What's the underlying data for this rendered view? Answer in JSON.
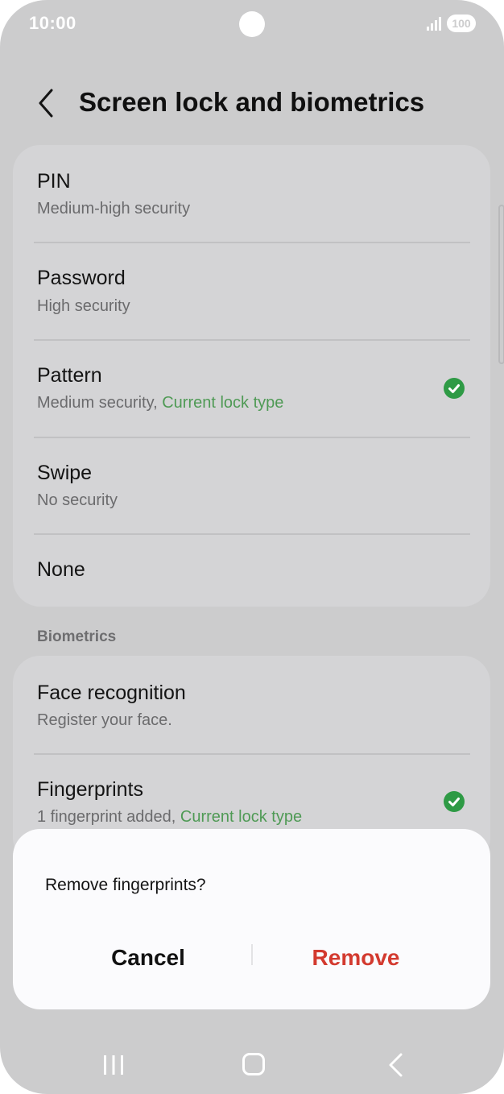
{
  "status_bar": {
    "time": "10:00",
    "battery": "100",
    "icons": [
      "camera-cutout",
      "signal-icon",
      "battery-icon"
    ]
  },
  "header": {
    "back_icon": "chevron-left-icon",
    "title": "Screen lock and biometrics"
  },
  "lock_types": [
    {
      "title": "PIN",
      "subtitle": "Medium-high security",
      "current": ""
    },
    {
      "title": "Password",
      "subtitle": "High security",
      "current": ""
    },
    {
      "title": "Pattern",
      "subtitle": "Medium security, ",
      "current": "Current lock type",
      "checked": true
    },
    {
      "title": "Swipe",
      "subtitle": "No security",
      "current": ""
    },
    {
      "title": "None",
      "subtitle": "",
      "current": ""
    }
  ],
  "biometrics": {
    "section_label": "Biometrics",
    "items": [
      {
        "title": "Face recognition",
        "subtitle": "Register your face.",
        "current": ""
      },
      {
        "title": "Fingerprints",
        "subtitle": "1 fingerprint added, ",
        "current": "Current lock type",
        "checked": true
      }
    ]
  },
  "dialog": {
    "message": "Remove fingerprints?",
    "cancel_label": "Cancel",
    "remove_label": "Remove"
  },
  "colors": {
    "overlay_background": "#cccccd",
    "accent_green": "#4f9a55",
    "check_green": "#2e9a45",
    "destructive_red": "#d33a2f"
  },
  "nav_bar": {
    "icons": [
      "recent-apps-icon",
      "home-icon",
      "back-icon"
    ]
  }
}
